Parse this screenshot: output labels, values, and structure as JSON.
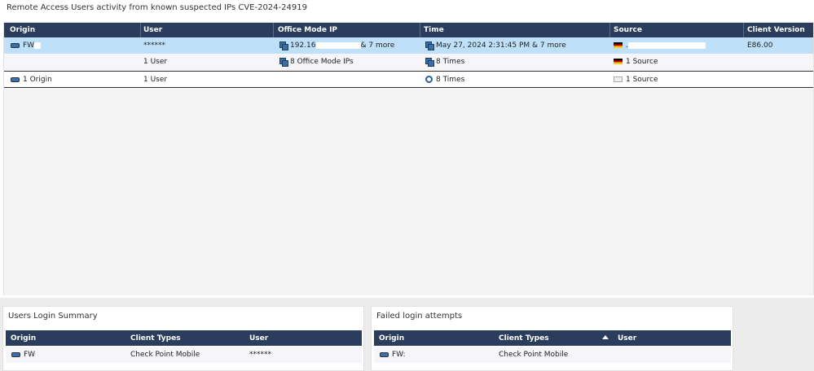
{
  "title": "Remote Access Users activity from known suspected IPs CVE-2024-24919",
  "main_table": {
    "columns": [
      "Origin",
      "User",
      "Office Mode IP",
      "Time",
      "Source",
      "Client Version"
    ],
    "row1": {
      "origin": "FW",
      "user": "******",
      "ip": "192.16",
      "ip_more": "& 7 more",
      "time": "May 27, 2024 2:31:45 PM & 7 more",
      "source": ".",
      "client_version": "E86.00"
    },
    "row2": {
      "user": "1 User",
      "ip": "8 Office Mode IPs",
      "time": "8 Times",
      "source": "1 Source"
    },
    "total": {
      "origin": "1 Origin",
      "user": "1 User",
      "time": "8 Times",
      "source": "1 Source"
    }
  },
  "login_summary": {
    "title": "Users Login Summary",
    "columns": [
      "Origin",
      "Client Types",
      "User"
    ],
    "row": {
      "origin": "FW",
      "client_type": "Check Point Mobile",
      "user": "******"
    }
  },
  "failed_logins": {
    "title": "Failed login attempts",
    "columns": [
      "Origin",
      "Client Types",
      "User"
    ],
    "row": {
      "origin": "FW:",
      "client_type": "Check Point Mobile"
    }
  },
  "colors": {
    "header": "#2a3d5c",
    "selected_row": "#bee0f8"
  },
  "icons": [
    "gateway-icon",
    "multi-value-icon",
    "clock-icon",
    "germany-flag-icon",
    "chart-icon",
    "sort-ascending-icon"
  ]
}
